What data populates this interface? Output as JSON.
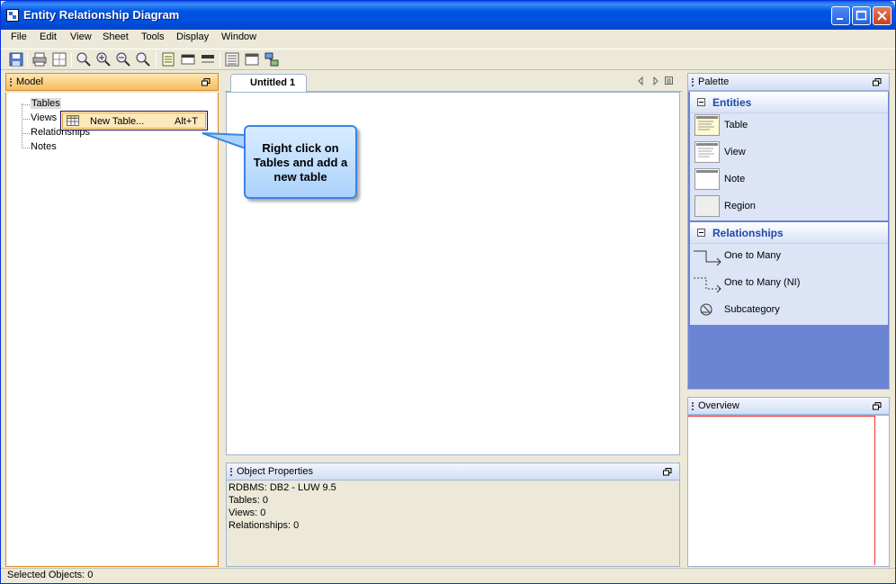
{
  "window": {
    "title": "Entity Relationship Diagram"
  },
  "menubar": [
    "File",
    "Edit",
    "View",
    "Sheet",
    "Tools",
    "Display",
    "Window"
  ],
  "model_panel": {
    "title": "Model",
    "tree": [
      "Tables",
      "Views",
      "Relationships",
      "Notes"
    ]
  },
  "context_menu": {
    "label": "New Table...",
    "shortcut": "Alt+T"
  },
  "callout": {
    "text": "Right click on Tables and add a new table"
  },
  "diagram": {
    "tab_label": "Untitled 1"
  },
  "object_properties": {
    "title": "Object Properties",
    "lines": [
      "RDBMS: DB2 - LUW 9.5",
      "Tables: 0",
      "Views: 0",
      "Relationships: 0"
    ]
  },
  "palette": {
    "title": "Palette",
    "entities": {
      "title": "Entities",
      "items": [
        "Table",
        "View",
        "Note",
        "Region"
      ]
    },
    "relationships": {
      "title": "Relationships",
      "items": [
        "One to Many",
        "One to Many (NI)",
        "Subcategory"
      ]
    }
  },
  "overview": {
    "title": "Overview"
  },
  "statusbar": {
    "text": "Selected Objects: 0"
  },
  "colors": {
    "titlebar": "#0055E5",
    "palette_bg": "#6B84D4",
    "model_header": "#F5BD62",
    "callout": "#ABD2FB"
  }
}
